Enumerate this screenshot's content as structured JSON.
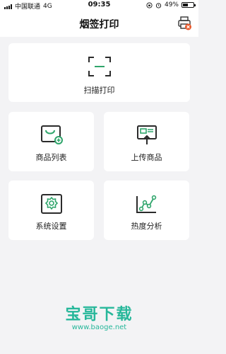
{
  "status_bar": {
    "carrier": "中国联通",
    "network": "4G",
    "time": "09:35",
    "battery": "49%",
    "battery_level": 0.49
  },
  "header": {
    "title": "烟签打印",
    "printer_icon": "printer-icon"
  },
  "cards": {
    "scan": {
      "label": "扫描打印",
      "icon": "scan-frame-icon"
    },
    "product_list": {
      "label": "商品列表",
      "icon": "basket-add-icon"
    },
    "upload_product": {
      "label": "上传商品",
      "icon": "upload-board-icon"
    },
    "system_settings": {
      "label": "系统设置",
      "icon": "gear-icon"
    },
    "heat_analysis": {
      "label": "热度分析",
      "icon": "trend-chart-icon"
    }
  },
  "watermark": {
    "title": "宝哥下载",
    "url": "www.baoge.net"
  },
  "colors": {
    "accent": "#2fa56b",
    "icon_dark": "#2b2b2b",
    "watermark": "#26b79a",
    "printer_badge": "#e8582b"
  }
}
